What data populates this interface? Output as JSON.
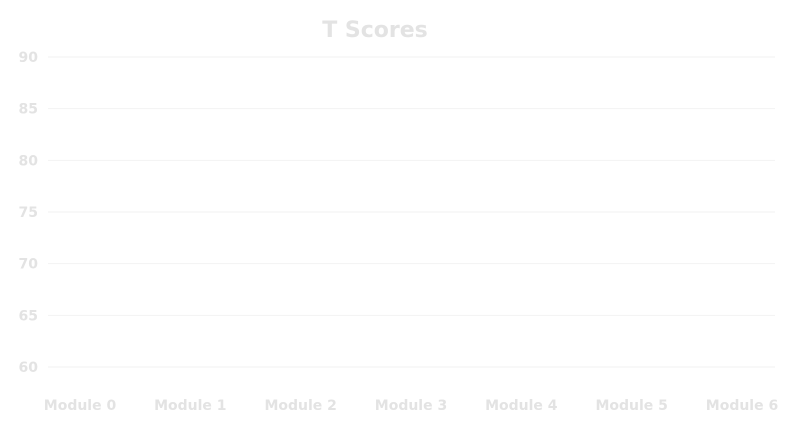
{
  "chart_data": {
    "type": "line",
    "title": "T Scores",
    "xlabel": "",
    "ylabel": "",
    "categories": [
      "Module 0",
      "Module 1",
      "Module 2",
      "Module 3",
      "Module 4",
      "Module 5",
      "Module 6"
    ],
    "series": [],
    "ylim": [
      60,
      90
    ],
    "yticks": [
      60,
      65,
      70,
      75,
      80,
      85,
      90
    ],
    "grid": true,
    "legend": "none",
    "colors": {
      "text": "#e3e3e3",
      "grid": "#f2f2f2",
      "background": "#ffffff"
    }
  }
}
